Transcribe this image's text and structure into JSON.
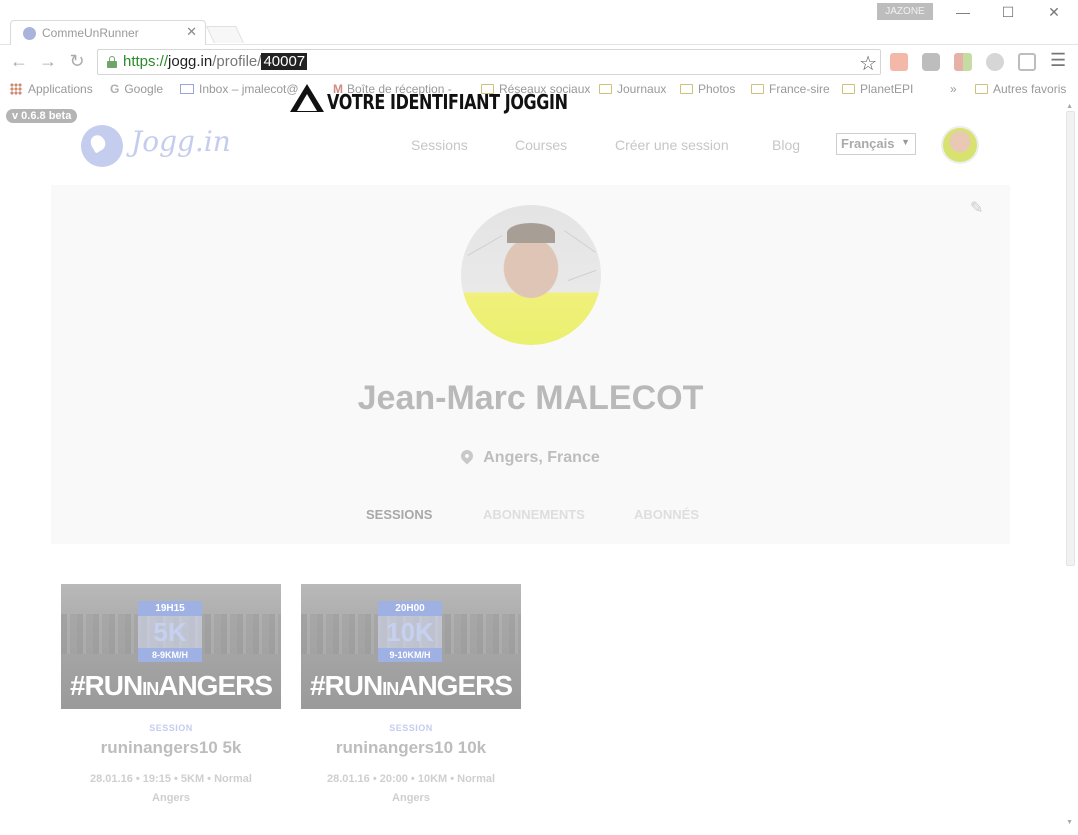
{
  "browser": {
    "tab_title": "CommeUnRunner",
    "tab_close": "✕",
    "profile_name": "JAZONE",
    "url_scheme": "https://",
    "url_host": "jogg.in",
    "url_path": "/profile/",
    "url_highlight": "40007",
    "window_controls": [
      "—",
      "☐",
      "✕"
    ],
    "bookmarks": [
      {
        "label": "Applications",
        "icon": "apps-icon"
      },
      {
        "label": "Google",
        "icon": "google-icon"
      },
      {
        "label": "Inbox – jmalecot@",
        "icon": "inbox-icon"
      },
      {
        "label": "Boîte de réception -",
        "icon": "gmail-icon"
      },
      {
        "label": "Réseaux sociaux",
        "icon": "folder-icon"
      },
      {
        "label": "Journaux",
        "icon": "folder-icon"
      },
      {
        "label": "Photos",
        "icon": "folder-icon"
      },
      {
        "label": "France-sire",
        "icon": "folder-icon"
      },
      {
        "label": "PlanetEPI",
        "icon": "folder-icon"
      }
    ],
    "bookmarks_overflow": "»",
    "other_bookmarks": "Autres favoris"
  },
  "annotation": {
    "text": "VOTRE IDENTIFIANT JOGGIN"
  },
  "page": {
    "version": "v 0.6.8 beta",
    "logo_text": "Jogg.in",
    "nav": [
      "Sessions",
      "Courses",
      "Créer une session",
      "Blog"
    ],
    "language": "Français",
    "profile": {
      "name": "Jean-Marc MALECOT",
      "location": "Angers, France",
      "tabs": [
        "SESSIONS",
        "ABONNEMENTS",
        "ABONNÉS"
      ],
      "active_tab": "SESSIONS"
    },
    "sessions": [
      {
        "time": "19H15",
        "distance": "5K",
        "pace": "8-9KM/H",
        "hashtag_a": "#RUN",
        "hashtag_b": "IN",
        "hashtag_c": "ANGERS",
        "kind": "SESSION",
        "title": "runinangers10 5k",
        "meta_line1": "28.01.16  •  19:15  •  5KM  •  Normal",
        "meta_line2": "Angers"
      },
      {
        "time": "20H00",
        "distance": "10K",
        "pace": "9-10KM/H",
        "hashtag_a": "#RUN",
        "hashtag_b": "IN",
        "hashtag_c": "ANGERS",
        "kind": "SESSION",
        "title": "runinangers10 10k",
        "meta_line1": "28.01.16  •  20:00  •  10KM  •  Normal",
        "meta_line2": "Angers"
      }
    ]
  },
  "colors": {
    "accent": "#c4cdee",
    "badge_blue": "#9fb0e3"
  }
}
